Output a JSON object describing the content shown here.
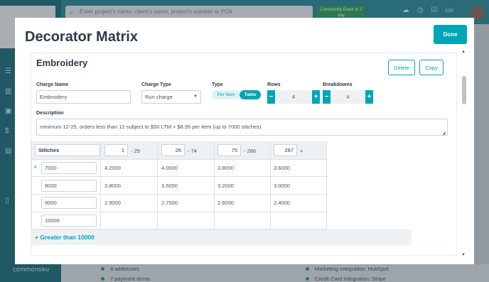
{
  "background": {
    "search_placeholder": "Enter project's name, client's name, project's number or PO#",
    "event_badge": "Community Event In 1 day",
    "brand": "commonsku",
    "count_badge": "100",
    "lower_left": [
      "8 addresses",
      "7 payment terms"
    ],
    "lower_right": [
      "Marketing Integration: HubSpot",
      "Credit Card Integration: Stripe"
    ]
  },
  "modal": {
    "title": "Decorator Matrix",
    "done_label": "Done"
  },
  "section": {
    "title": "Embroidery",
    "delete_label": "Delete",
    "copy_label": "Copy"
  },
  "form": {
    "charge_name_label": "Charge Name",
    "charge_name_value": "Embroidery",
    "charge_type_label": "Charge Type",
    "charge_type_value": "Run charge",
    "type_label": "Type",
    "type_options": [
      "Per Item",
      "Table"
    ],
    "type_selected": "Table",
    "rows_label": "Rows",
    "rows_value": "4",
    "breakdowns_label": "Breakdowns",
    "breakdowns_value": "4",
    "minus": "−",
    "plus": "+",
    "description_label": "Description",
    "description_value": "minimum 12-25, orders less than 12 subject to $50 LTM + $8.95 per item (up to 7000 stitches)"
  },
  "matrix": {
    "header_label": "Stitches",
    "ranges": [
      {
        "from": "1",
        "to": "- 25"
      },
      {
        "from": "26",
        "to": "- 74"
      },
      {
        "from": "75",
        "to": "- 286"
      },
      {
        "from": "287",
        "to": "+"
      }
    ],
    "rows": [
      {
        "key": "7000",
        "values": [
          "4.2000",
          "4.0000",
          "3.8000",
          "3.6000"
        ]
      },
      {
        "key": "8000",
        "values": [
          "3.8000",
          "3.5000",
          "3.2000",
          "3.0000"
        ]
      },
      {
        "key": "9000",
        "values": [
          "2.9000",
          "2.7500",
          "2.6000",
          "2.4000"
        ]
      },
      {
        "key": "10000",
        "values": [
          "",
          "",
          "",
          ""
        ]
      }
    ],
    "add_label": "+ Greater than 10000"
  },
  "colors": {
    "accent": "#00a5b5",
    "sidebar": "#1c6e78"
  }
}
